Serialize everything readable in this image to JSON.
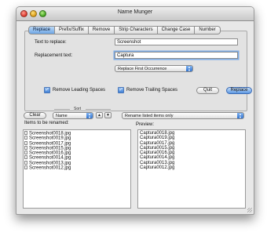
{
  "window": {
    "title": "Name Munger"
  },
  "tabs": [
    {
      "label": "Replace",
      "active": true
    },
    {
      "label": "Prefix/Suffix"
    },
    {
      "label": "Remove"
    },
    {
      "label": "Strip Characters"
    },
    {
      "label": "Change Case"
    },
    {
      "label": "Number"
    }
  ],
  "replace": {
    "text_label": "Text to replace:",
    "text_value": "Screenshot",
    "replacement_label": "Replacement text:",
    "replacement_value": "Captura",
    "mode_selected": "Replace First Occurrence"
  },
  "options": {
    "remove_leading": {
      "label": "Remove Leading Spaces",
      "checked": true
    },
    "remove_trailing": {
      "label": "Remove Trailing Spaces",
      "checked": true
    }
  },
  "buttons": {
    "quit": "Quit",
    "replace": "Replace",
    "clear": "Clear"
  },
  "sort": {
    "label": "Sort",
    "selected": "Name",
    "up": "▲",
    "down": "▼"
  },
  "action": {
    "selected": "Rename listed items only"
  },
  "lists": {
    "items_label": "Items to be renamed:",
    "preview_label": "Preview:",
    "items": [
      "Screenshot0018.jpg",
      "Screenshot0019.jpg",
      "Screenshot0017.jpg",
      "Screenshot0015.jpg",
      "Screenshot0016.jpg",
      "Screenshot0014.jpg",
      "Screenshot0013.jpg",
      "Screenshot0012.jpg"
    ],
    "preview": [
      "Captura0018.jpg",
      "Captura0019.jpg",
      "Captura0017.jpg",
      "Captura0015.jpg",
      "Captura0016.jpg",
      "Captura0014.jpg",
      "Captura0013.jpg",
      "Captura0012.jpg"
    ]
  },
  "colors": {
    "accent": "#5c98e2",
    "window_bg": "#e8e8e8"
  }
}
